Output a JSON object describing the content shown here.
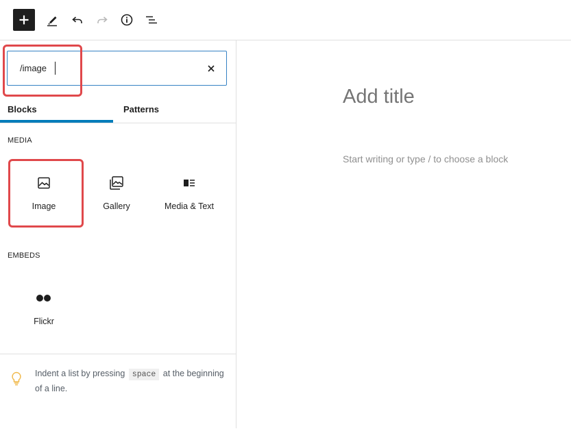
{
  "toolbar": {
    "add": "add-block-toggle",
    "tools": "edit-tool",
    "undo": "undo",
    "redo": "redo",
    "details": "details",
    "list_view": "list-view"
  },
  "inserter": {
    "search_value": "/image",
    "tabs": {
      "blocks": "Blocks",
      "patterns": "Patterns"
    },
    "categories": {
      "media": "MEDIA",
      "embeds": "EMBEDS"
    },
    "media_blocks": [
      {
        "label": "Image",
        "icon": "image-icon"
      },
      {
        "label": "Gallery",
        "icon": "gallery-icon"
      },
      {
        "label": "Media & Text",
        "icon": "media-text-icon"
      }
    ],
    "embed_blocks": [
      {
        "label": "Flickr",
        "icon": "flickr-icon"
      }
    ],
    "tip": {
      "before": "Indent a list by pressing ",
      "code": "space",
      "after": " at the beginning of a line."
    }
  },
  "editor": {
    "title_placeholder": "Add title",
    "body_placeholder": "Start writing or type / to choose a block"
  },
  "colors": {
    "accent": "#007cba",
    "focus_border": "#3582c4",
    "annotation": "#e0484b",
    "tip_icon": "#f0b849"
  }
}
